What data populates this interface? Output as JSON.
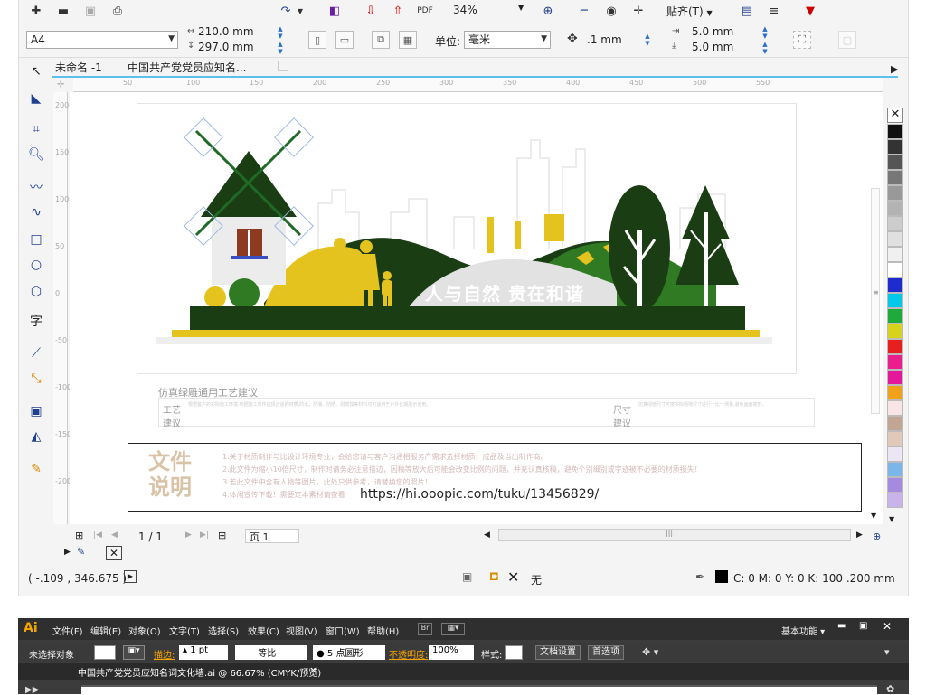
{
  "cdr": {
    "zoom": "34%",
    "snap_label": "贴齐(T)",
    "page_size": "A4",
    "width": "210.0 mm",
    "height": "297.0 mm",
    "units_label": "单位:",
    "units_value": "毫米",
    "nudge": ".1 mm",
    "dup_x": "5.0 mm",
    "dup_y": "5.0 mm",
    "tabs": [
      "未命名 -1",
      "中国共产党党员应知名..."
    ],
    "ruler_ticks": [
      "50",
      "100",
      "150",
      "200",
      "250",
      "300",
      "350",
      "400",
      "450",
      "500",
      "550"
    ],
    "vruler_ticks": [
      "200",
      "150",
      "100",
      "50",
      "0",
      "-50",
      "-100",
      "-150",
      "-200"
    ],
    "page_counter": "1 / 1",
    "page_tab": "页 1",
    "coords": "( -.109 , 346.675 )",
    "fill_label": "无",
    "stroke_info": "C: 0 M: 0 Y: 0 K: 100  .200 mm",
    "palette": [
      "#111111",
      "#333333",
      "#555555",
      "#777777",
      "#999999",
      "#b3b3b3",
      "#cccccc",
      "#e0e0e0",
      "#f0f0f0",
      "#ffffff",
      "#1e2ccf",
      "#00c8e8",
      "#1faa3c",
      "#d7d21b",
      "#e81f1f",
      "#ea1e8c",
      "#e4189a",
      "#f0a21a",
      "#f7e4e4",
      "#c3a593",
      "#e0c9b9",
      "#ece6f4",
      "#7ab7e8",
      "#a58be0",
      "#c8b3ea"
    ]
  },
  "design": {
    "slogan": "人与自然 贵在和谐",
    "spec_title": "仿真绿雕通用工艺建议",
    "spec_col1_label_a": "工艺",
    "spec_col1_label_b": "建议",
    "spec_col1_text": "根据客户的实际施工环境,依据施工条件选择合适的材质;防水、防潮、防晒、耐腐蚀等材料均可适用于户外长期展示使用。",
    "spec_col2_label_a": "尺寸",
    "spec_col2_label_b": "建议",
    "spec_col2_text": "仿真绿植尺寸可按实际场地尺寸进行一比一测量,避免画面变形。",
    "doc_title_a": "文件",
    "doc_title_b": "说明",
    "doc_lines": [
      "1.关于材质制作与比设计环境专业，会给您请与客户沟通相服务产需求选择材质，成品及当出制作商。",
      "2.此文件为缩小10倍尺寸，制作时请务必注意描边，因稿等放大后可能会改变比例的问题，并充认真核稿，避免个别细别或字迹被不必要的材质损失！",
      "3.若此文件中含有人物等图片，此处只供参考，请替换您的照片！",
      "4.体闲宣传下载！需要定本素材请查看"
    ],
    "url": "https://hi.ooopic.com/tuku/13456829/"
  },
  "ai": {
    "logo": "Ai",
    "menu": [
      "文件(F)",
      "编辑(E)",
      "对象(O)",
      "文字(T)",
      "选择(S)",
      "效果(C)",
      "视图(V)",
      "窗口(W)",
      "帮助(H)"
    ],
    "workspace": "基本功能",
    "no_selection": "未选择对象",
    "stroke_label": "描边:",
    "stroke_value": "1 pt",
    "stroke_style": "等比",
    "brush_value": "5 点圆形",
    "opacity_label": "不透明度:",
    "opacity_value": "100%",
    "style_label": "样式:",
    "doc_settings": "文档设置",
    "preferences": "首选项",
    "doc_tab": "中国共产党党员应知名词文化墙.ai @ 66.67% (CMYK/预览)",
    "close_x": "×"
  }
}
